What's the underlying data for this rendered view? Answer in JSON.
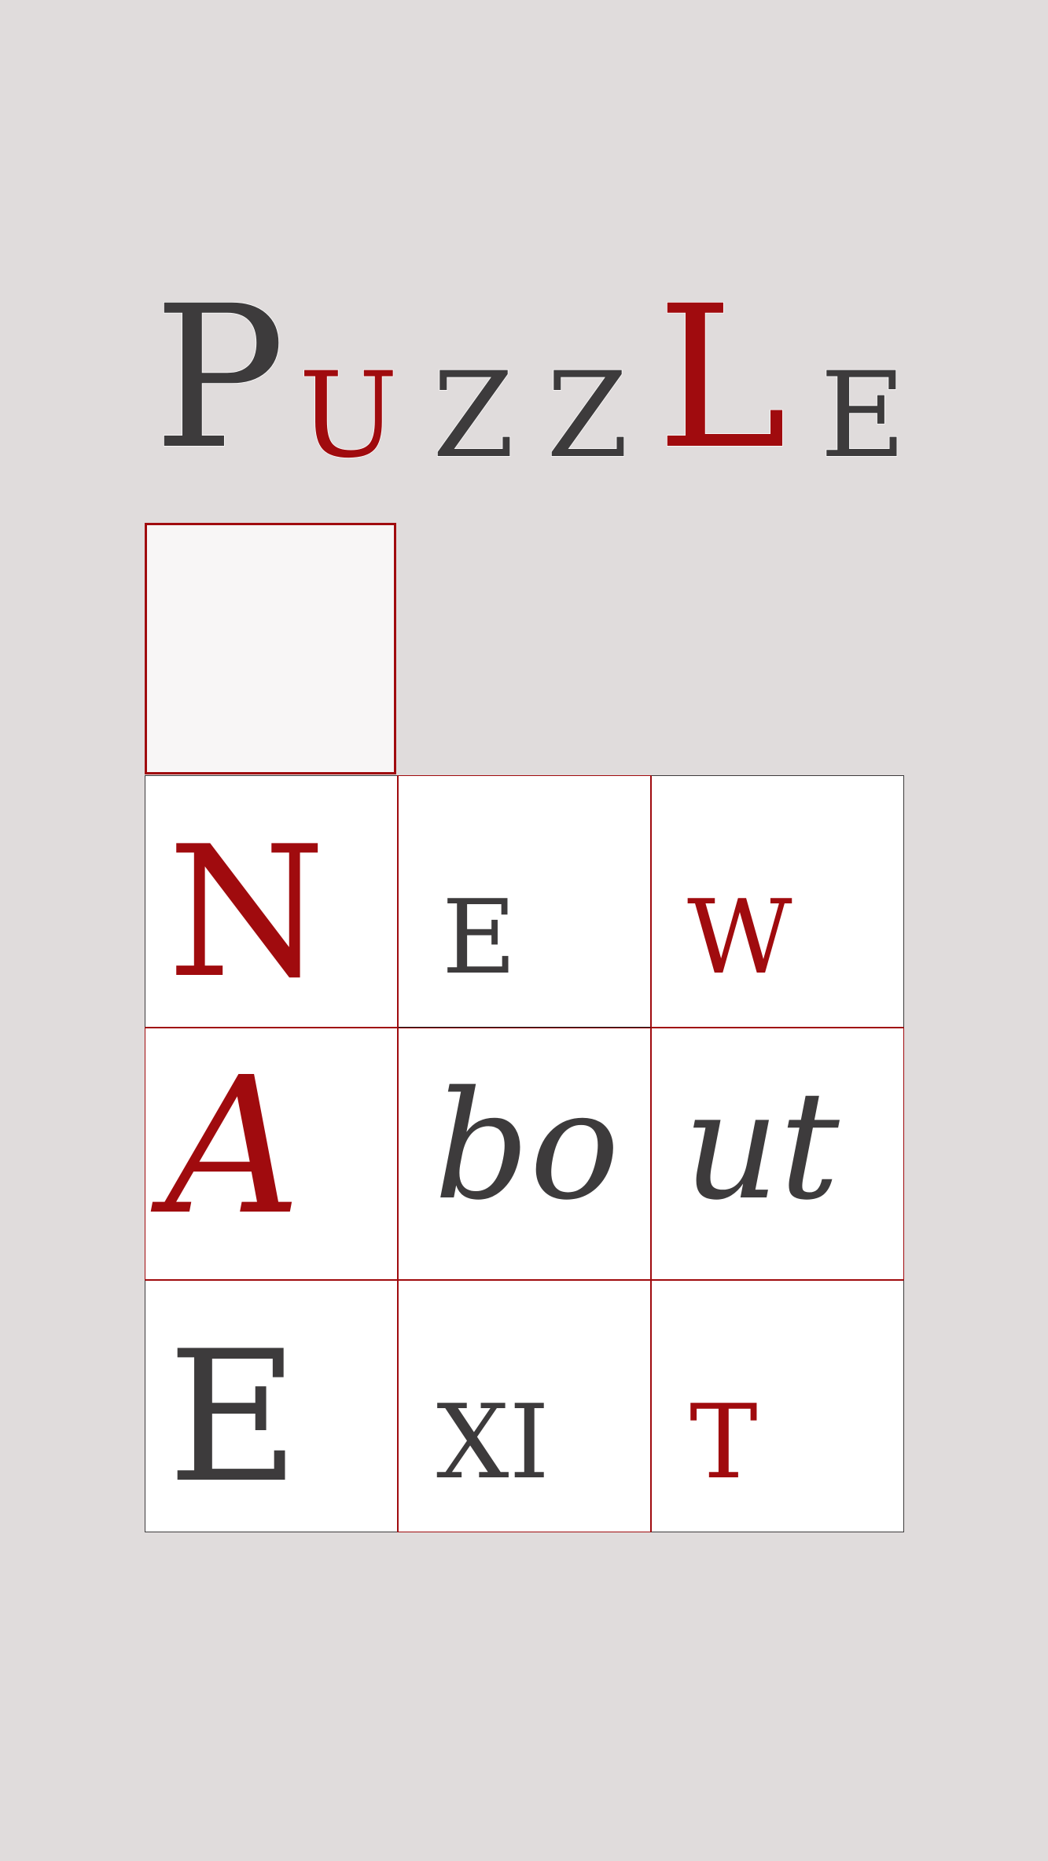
{
  "title": {
    "letters": [
      "P",
      "U",
      "Z",
      "Z",
      "L",
      "E"
    ]
  },
  "colors": {
    "background": "#e0dcdc",
    "accent": "#a00b0e",
    "text_dark": "#3d3b3c",
    "tile": "#ffffff",
    "empty_slot": "#f8f6f6"
  },
  "tiles": [
    {
      "text": "N"
    },
    {
      "text": "E"
    },
    {
      "text": "W"
    },
    {
      "text": "A"
    },
    {
      "text": "bo"
    },
    {
      "text": "ut"
    },
    {
      "text": "E"
    },
    {
      "text": "XI"
    },
    {
      "text": "T"
    }
  ]
}
